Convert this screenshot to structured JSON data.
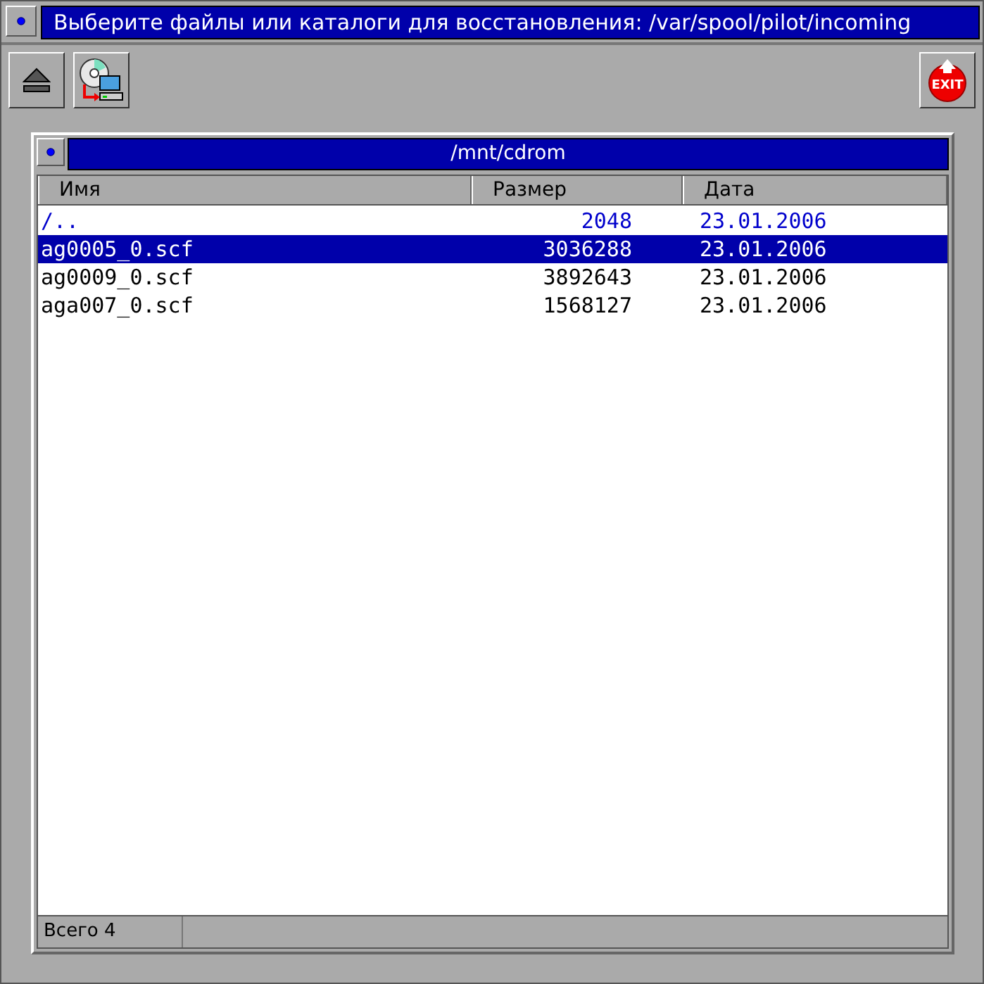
{
  "window": {
    "title": "Выберите файлы или каталоги для восстановления: /var/spool/pilot/incoming"
  },
  "toolbar": {
    "exit_label": "EXIT"
  },
  "panel": {
    "title": "/mnt/cdrom"
  },
  "table": {
    "columns": [
      "Имя",
      "Размер",
      "Дата"
    ],
    "rows": [
      {
        "kind": "parent",
        "selected": false,
        "cells": [
          "/..",
          "2048",
          "23.01.2006"
        ]
      },
      {
        "kind": "file",
        "selected": true,
        "cells": [
          "ag0005_0.scf",
          "3036288",
          "23.01.2006"
        ]
      },
      {
        "kind": "file",
        "selected": false,
        "cells": [
          "ag0009_0.scf",
          "3892643",
          "23.01.2006"
        ]
      },
      {
        "kind": "file",
        "selected": false,
        "cells": [
          "aga007_0.scf",
          "1568127",
          "23.01.2006"
        ]
      }
    ]
  },
  "status_bar": {
    "text": "Всего 4"
  }
}
